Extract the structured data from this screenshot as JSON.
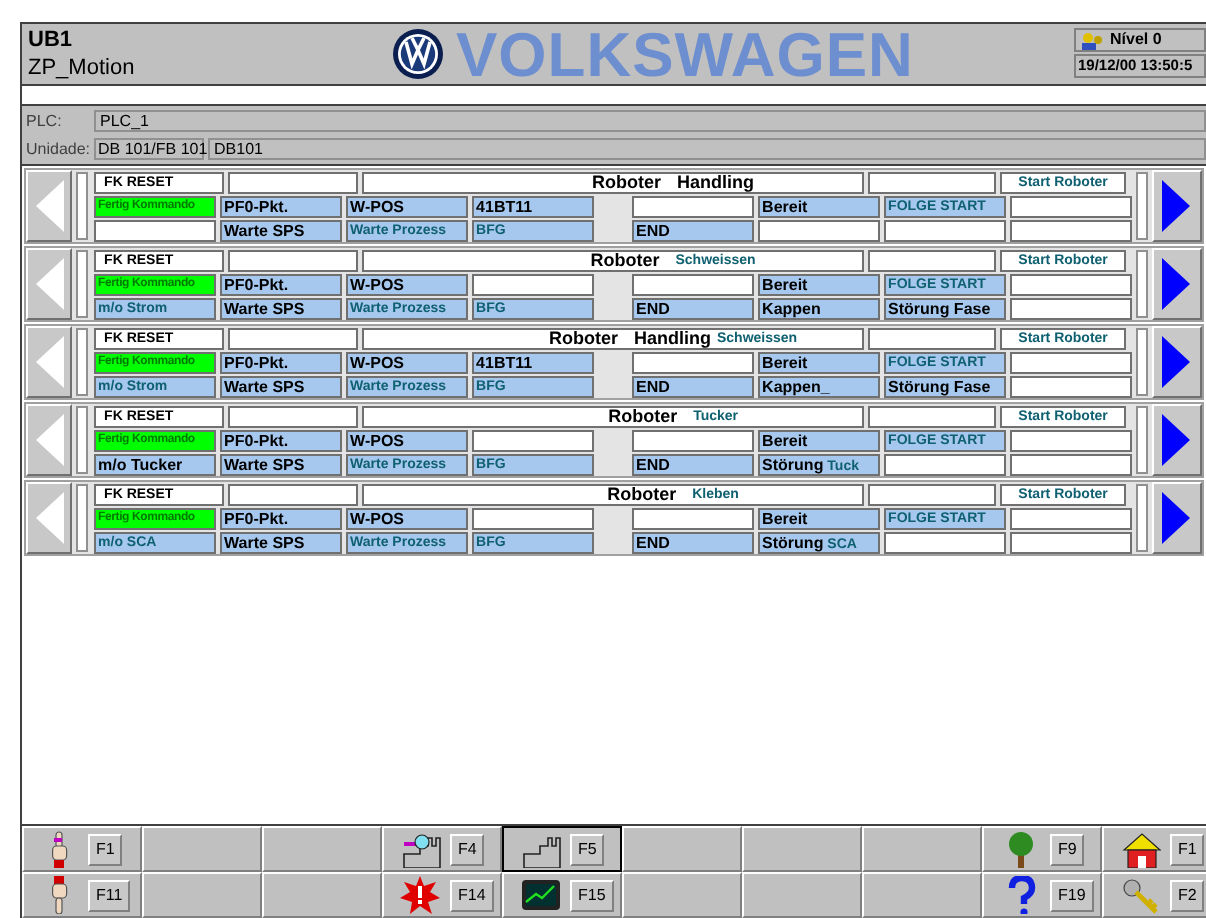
{
  "header": {
    "line1": "UB1",
    "line2": "ZP_Motion",
    "brand": "VOLKSWAGEN",
    "level_label": "Nível 0",
    "datetime": "19/12/00 13:50:5"
  },
  "plc": {
    "label": "PLC:",
    "value": "PLC_1"
  },
  "unit": {
    "label": "Unidade:",
    "value": "DB 101/FB 101",
    "value2": "DB101"
  },
  "robots": [
    {
      "reset": "FK RESET",
      "title": {
        "label": "Roboter",
        "name": "Handling"
      },
      "start": "Start Roboter",
      "row2": [
        {
          "kind": "green",
          "text": "Fertig Kommando"
        },
        {
          "kind": "blue",
          "text": "PF0-Pkt."
        },
        {
          "kind": "blue",
          "text": "W-POS"
        },
        {
          "kind": "blue",
          "text": "41BT11"
        },
        {
          "kind": "white"
        },
        {
          "kind": "blue",
          "text": "Bereit"
        },
        {
          "kind": "teal",
          "text": "FOLGE START"
        },
        {
          "kind": "white"
        }
      ],
      "row3": [
        {
          "kind": "white"
        },
        {
          "kind": "blue",
          "text": "Warte SPS"
        },
        {
          "kind": "teal",
          "text": "Warte Prozess"
        },
        {
          "kind": "teal",
          "text": "BFG"
        },
        {
          "kind": "blue",
          "text": "END"
        },
        {
          "kind": "white"
        },
        {
          "kind": "white"
        },
        {
          "kind": "white"
        }
      ]
    },
    {
      "reset": "FK RESET",
      "title": {
        "label": "Roboter",
        "process": "Schweissen"
      },
      "start": "Start Roboter",
      "row2": [
        {
          "kind": "green",
          "text": "Fertig Kommando"
        },
        {
          "kind": "blue",
          "text": "PF0-Pkt."
        },
        {
          "kind": "blue",
          "text": "W-POS"
        },
        {
          "kind": "white"
        },
        {
          "kind": "white"
        },
        {
          "kind": "blue",
          "text": "Bereit"
        },
        {
          "kind": "teal",
          "text": "FOLGE START"
        },
        {
          "kind": "white"
        }
      ],
      "row3": [
        {
          "kind": "teal",
          "text": "m/o Strom"
        },
        {
          "kind": "blue",
          "text": "Warte SPS"
        },
        {
          "kind": "teal",
          "text": "Warte Prozess"
        },
        {
          "kind": "teal",
          "text": "BFG"
        },
        {
          "kind": "blue",
          "text": "END"
        },
        {
          "kind": "blue",
          "text": "Kappen"
        },
        {
          "kind": "blue",
          "text": "Störung Fase"
        },
        {
          "kind": "white"
        }
      ]
    },
    {
      "reset": "FK RESET",
      "title": {
        "label": "Roboter",
        "name": "Handling",
        "process": "Schweissen"
      },
      "start": "Start Roboter",
      "row2": [
        {
          "kind": "green",
          "text": "Fertig Kommando"
        },
        {
          "kind": "blue",
          "text": "PF0-Pkt."
        },
        {
          "kind": "blue",
          "text": "W-POS"
        },
        {
          "kind": "blue",
          "text": "41BT11"
        },
        {
          "kind": "white"
        },
        {
          "kind": "blue",
          "text": "Bereit"
        },
        {
          "kind": "teal",
          "text": "FOLGE START"
        },
        {
          "kind": "white"
        }
      ],
      "row3": [
        {
          "kind": "teal",
          "text": "m/o Strom"
        },
        {
          "kind": "blue",
          "text": "Warte SPS"
        },
        {
          "kind": "teal",
          "text": "Warte Prozess"
        },
        {
          "kind": "teal",
          "text": "BFG"
        },
        {
          "kind": "blue",
          "text": "END"
        },
        {
          "kind": "blue",
          "text": "Kappen_"
        },
        {
          "kind": "blue",
          "text": "Störung Fase"
        },
        {
          "kind": "white"
        }
      ]
    },
    {
      "reset": "FK RESET",
      "title": {
        "label": "Roboter",
        "process": "Tucker"
      },
      "start": "Start Roboter",
      "row2": [
        {
          "kind": "green",
          "text": "Fertig Kommando"
        },
        {
          "kind": "blue",
          "text": "PF0-Pkt."
        },
        {
          "kind": "blue",
          "text": "W-POS"
        },
        {
          "kind": "white"
        },
        {
          "kind": "white"
        },
        {
          "kind": "blue",
          "text": "Bereit"
        },
        {
          "kind": "teal",
          "text": "FOLGE START"
        },
        {
          "kind": "white"
        }
      ],
      "row3": [
        {
          "kind": "blue",
          "text": "m/o Tucker"
        },
        {
          "kind": "blue",
          "text": "Warte SPS"
        },
        {
          "kind": "teal",
          "text": "Warte Prozess"
        },
        {
          "kind": "teal",
          "text": "BFG"
        },
        {
          "kind": "blue",
          "text": "END"
        },
        {
          "kind": "blue",
          "text": "Störung",
          "suffix": "Tuck"
        },
        {
          "kind": "white"
        },
        {
          "kind": "white"
        }
      ]
    },
    {
      "reset": "FK RESET",
      "title": {
        "label": "Roboter",
        "process": "Kleben"
      },
      "start": "Start Roboter",
      "row2": [
        {
          "kind": "green",
          "text": "Fertig Kommando"
        },
        {
          "kind": "blue",
          "text": "PF0-Pkt."
        },
        {
          "kind": "blue",
          "text": "W-POS"
        },
        {
          "kind": "white"
        },
        {
          "kind": "white"
        },
        {
          "kind": "blue",
          "text": "Bereit"
        },
        {
          "kind": "teal",
          "text": "FOLGE START"
        },
        {
          "kind": "white"
        }
      ],
      "row3": [
        {
          "kind": "teal",
          "text": "m/o SCA"
        },
        {
          "kind": "blue",
          "text": "Warte SPS"
        },
        {
          "kind": "teal",
          "text": "Warte Prozess"
        },
        {
          "kind": "teal",
          "text": "BFG"
        },
        {
          "kind": "blue",
          "text": "END"
        },
        {
          "kind": "blue",
          "text": "Störung",
          "suffix": "SCA"
        },
        {
          "kind": "white"
        },
        {
          "kind": "white"
        }
      ]
    }
  ],
  "function_keys": [
    [
      {
        "kind": "hand-up",
        "label": "F1",
        "pressed": false
      },
      {
        "kind": "blank"
      },
      {
        "kind": "blank"
      },
      {
        "kind": "factory-search",
        "label": "F4",
        "pressed": false
      },
      {
        "kind": "factory",
        "label": "F5",
        "pressed": true
      },
      {
        "kind": "blank"
      },
      {
        "kind": "blank"
      },
      {
        "kind": "blank"
      },
      {
        "kind": "tree",
        "label": "F9",
        "pressed": false
      },
      {
        "kind": "house",
        "label": "F1",
        "pressed": false
      }
    ],
    [
      {
        "kind": "hand-down",
        "label": "F11",
        "pressed": false
      },
      {
        "kind": "blank"
      },
      {
        "kind": "blank"
      },
      {
        "kind": "alarm",
        "label": "F14",
        "pressed": false
      },
      {
        "kind": "monitor",
        "label": "F15",
        "pressed": false
      },
      {
        "kind": "blank"
      },
      {
        "kind": "blank"
      },
      {
        "kind": "blank"
      },
      {
        "kind": "help",
        "label": "F19",
        "pressed": false
      },
      {
        "kind": "keys",
        "label": "F2",
        "pressed": false
      }
    ]
  ]
}
